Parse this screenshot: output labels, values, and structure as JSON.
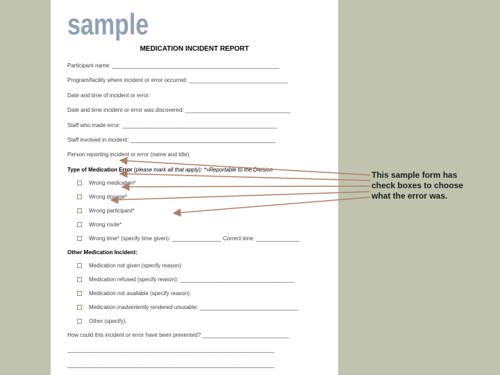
{
  "watermark": "sample",
  "title": "MEDICATION INCIDENT REPORT",
  "fields": {
    "f0": "Participant name: ______________________________________________________",
    "f1": "Program/facility where incident or error occurred: ________________________________",
    "f2": "Date and time of incident or error:",
    "f3": "Date and time incident or error was discovered: __________________________________",
    "f4": "Staff who made error: __________________________________________________",
    "f5": "Staff involved in incident: _______________________________________________",
    "f6": "Person reporting incident or error (name and title):"
  },
  "section1": {
    "heading": "Type of Medication Error",
    "note": "(please mark all that apply): *=Reportable to the Division"
  },
  "errors": {
    "e0": "Wrong medication*",
    "e1": "Wrong dosage*",
    "e2": "Wrong participant*",
    "e3": "Wrong route*",
    "e4": "Wrong time* (specify time given): ________________   Correct time: ______________"
  },
  "section2": {
    "heading": "Other Medication Incident:"
  },
  "others": {
    "o0": "Medication not given (specify reason):",
    "o1": "Medication refused (specify reason): _____________________________________",
    "o2": "Medication not available (specify reason):",
    "o3": "Medication inadvertently rendered unusable: ________________________________",
    "o4": "Other (specify):"
  },
  "tail": {
    "t0": "How could this incident or error have been prevented? ____________________________",
    "t1": "___________________________________________________________________",
    "t2": "___________________________________________________________________"
  },
  "callout": "This sample form has check boxes to choose what the error was."
}
